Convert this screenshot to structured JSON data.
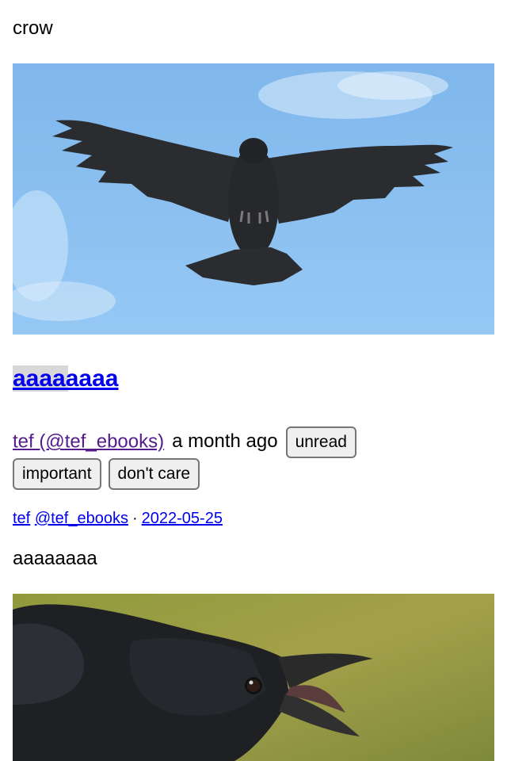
{
  "intro": {
    "text": "crow"
  },
  "images": [
    {
      "name": "crow flying in blue sky"
    },
    {
      "name": "crow head with open beak"
    }
  ],
  "entry": {
    "title": "aaaaaaaa",
    "author": "tef (@tef_ebooks)",
    "time_ago": "a month ago",
    "tags": [
      "unread",
      "important",
      "don't care"
    ]
  },
  "post": {
    "author_name": "tef",
    "author_handle": "@tef_ebooks",
    "separator": "·",
    "date": "2022-05-25",
    "body": "aaaaaaaa"
  },
  "colors": {
    "link": "#0000ee",
    "visited_link": "#551a8b",
    "button_bg": "#efefef",
    "button_border": "#767676",
    "sky": "#8ec2f0",
    "crow": "#2a2c30"
  }
}
